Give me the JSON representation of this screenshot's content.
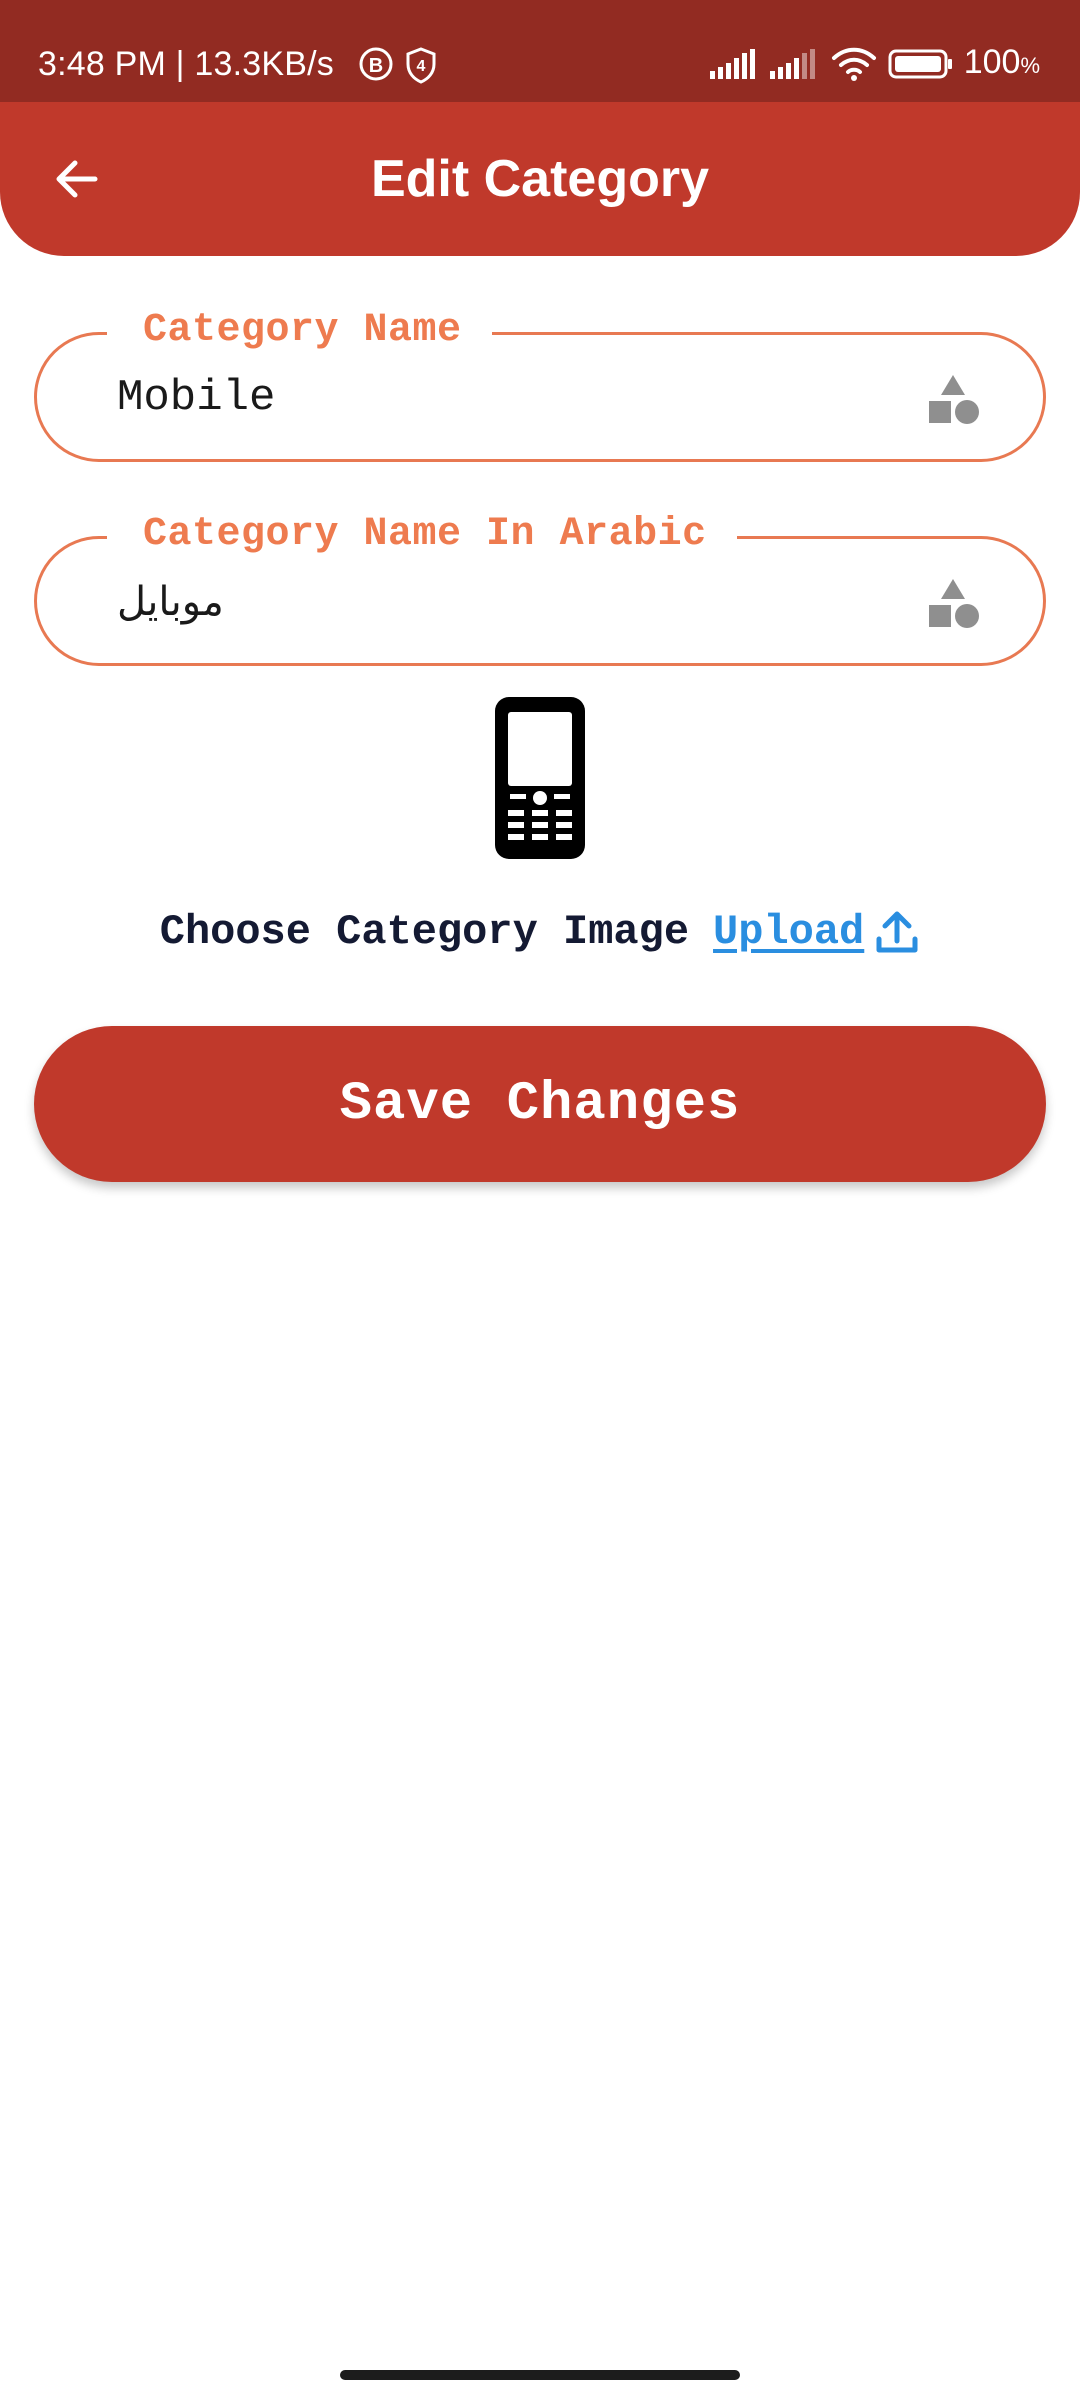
{
  "status_bar": {
    "time_speed": "3:48 PM | 13.3KB/s",
    "battery_level": "100",
    "battery_unit": "%",
    "icons": [
      "b-circle-icon",
      "shield-4-icon",
      "signal-icon",
      "signal-icon",
      "wifi-icon",
      "battery-icon"
    ]
  },
  "app_bar": {
    "title": "Edit Category",
    "back_icon": "arrow-left-icon"
  },
  "form": {
    "category_name": {
      "label": "Category Name",
      "value": "Mobile",
      "icon": "shapes-icon"
    },
    "category_name_arabic": {
      "label": "Category Name In Arabic",
      "value": "موبايل",
      "icon": "shapes-icon"
    },
    "image": {
      "icon": "mobile-phone-icon",
      "choose_label": "Choose Category Image",
      "upload_link": "Upload",
      "upload_icon": "upload-icon"
    },
    "save_button": "Save Changes"
  },
  "colors": {
    "status_bar": "#922b22",
    "primary": "#c0392b",
    "field_border": "#e87952",
    "field_label": "#ee7b4f",
    "link": "#2a8ee0",
    "text_dark": "#141a33"
  }
}
